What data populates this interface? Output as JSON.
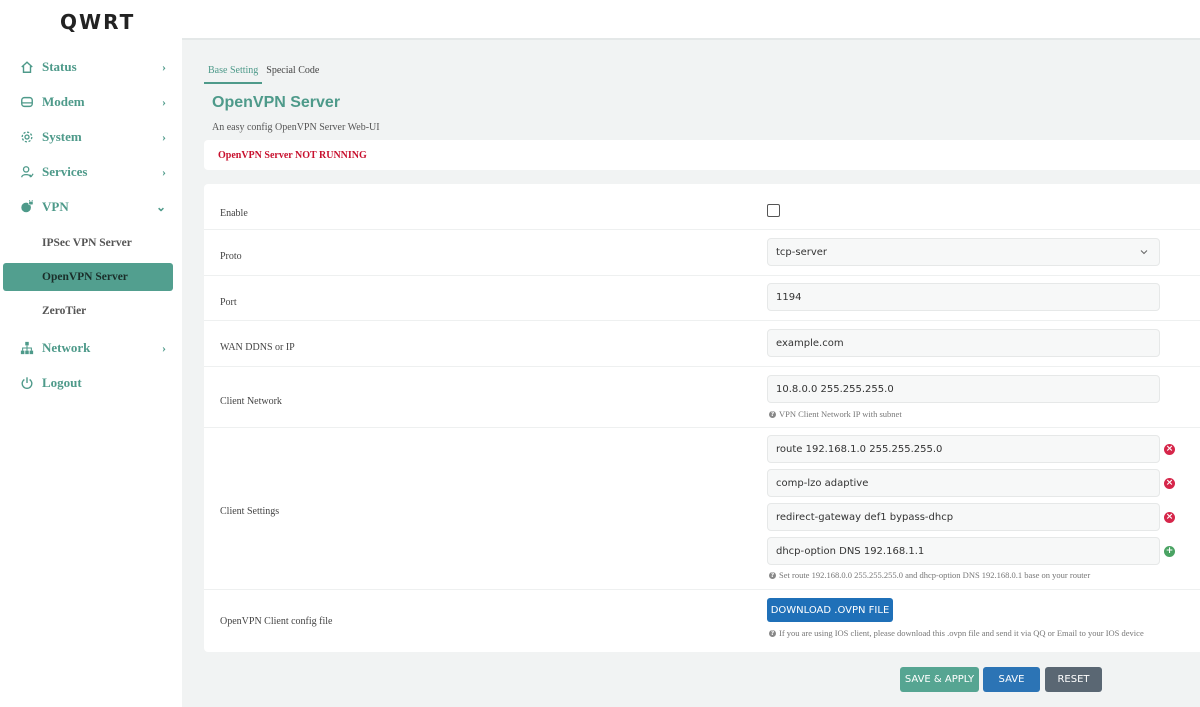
{
  "app": {
    "logo": "QWRT"
  },
  "sidebar": {
    "items": [
      {
        "label": "Status",
        "icon": "home-icon"
      },
      {
        "label": "Modem",
        "icon": "hdd-icon"
      },
      {
        "label": "System",
        "icon": "gear-icon"
      },
      {
        "label": "Services",
        "icon": "user-icon"
      },
      {
        "label": "VPN",
        "icon": "globe-lock-icon",
        "expanded": true
      },
      {
        "label": "Network",
        "icon": "sitemap-icon"
      },
      {
        "label": "Logout",
        "icon": "power-icon"
      }
    ],
    "vpn_sub": [
      {
        "label": "IPSec VPN Server"
      },
      {
        "label": "OpenVPN Server",
        "active": true
      },
      {
        "label": "ZeroTier"
      }
    ]
  },
  "tabs": [
    {
      "label": "Base Setting",
      "active": true
    },
    {
      "label": "Special Code"
    }
  ],
  "page": {
    "title": "OpenVPN Server",
    "description": "An easy config OpenVPN Server Web-UI",
    "status": "OpenVPN Server NOT RUNNING"
  },
  "form": {
    "enable_label": "Enable",
    "enable_checked": false,
    "proto_label": "Proto",
    "proto_value": "tcp-server",
    "port_label": "Port",
    "port_value": "1194",
    "wan_label": "WAN DDNS or IP",
    "wan_value": "example.com",
    "client_network_label": "Client Network",
    "client_network_value": "10.8.0.0 255.255.255.0",
    "client_network_hint": "VPN Client Network IP with subnet",
    "client_settings_label": "Client Settings",
    "client_settings": [
      "route 192.168.1.0 255.255.255.0",
      "comp-lzo adaptive",
      "redirect-gateway def1 bypass-dhcp",
      "dhcp-option DNS 192.168.1.1"
    ],
    "client_settings_hint": "Set route 192.168.0.0 255.255.255.0 and dhcp-option DNS 192.168.0.1 base on your router",
    "config_file_label": "OpenVPN Client config file",
    "download_label": "DOWNLOAD .OVPN FILE",
    "config_file_hint": "If you are using IOS client, please download this .ovpn file and send it via QQ or Email to your IOS device"
  },
  "actions": {
    "save_apply": "SAVE & APPLY",
    "save": "SAVE",
    "reset": "RESET"
  },
  "colors": {
    "accent": "#4e9a8a",
    "active_item": "#529f8f",
    "error": "#c8102e",
    "primary": "#1f70b8",
    "remove": "#d6264a",
    "add": "#4aa363"
  }
}
